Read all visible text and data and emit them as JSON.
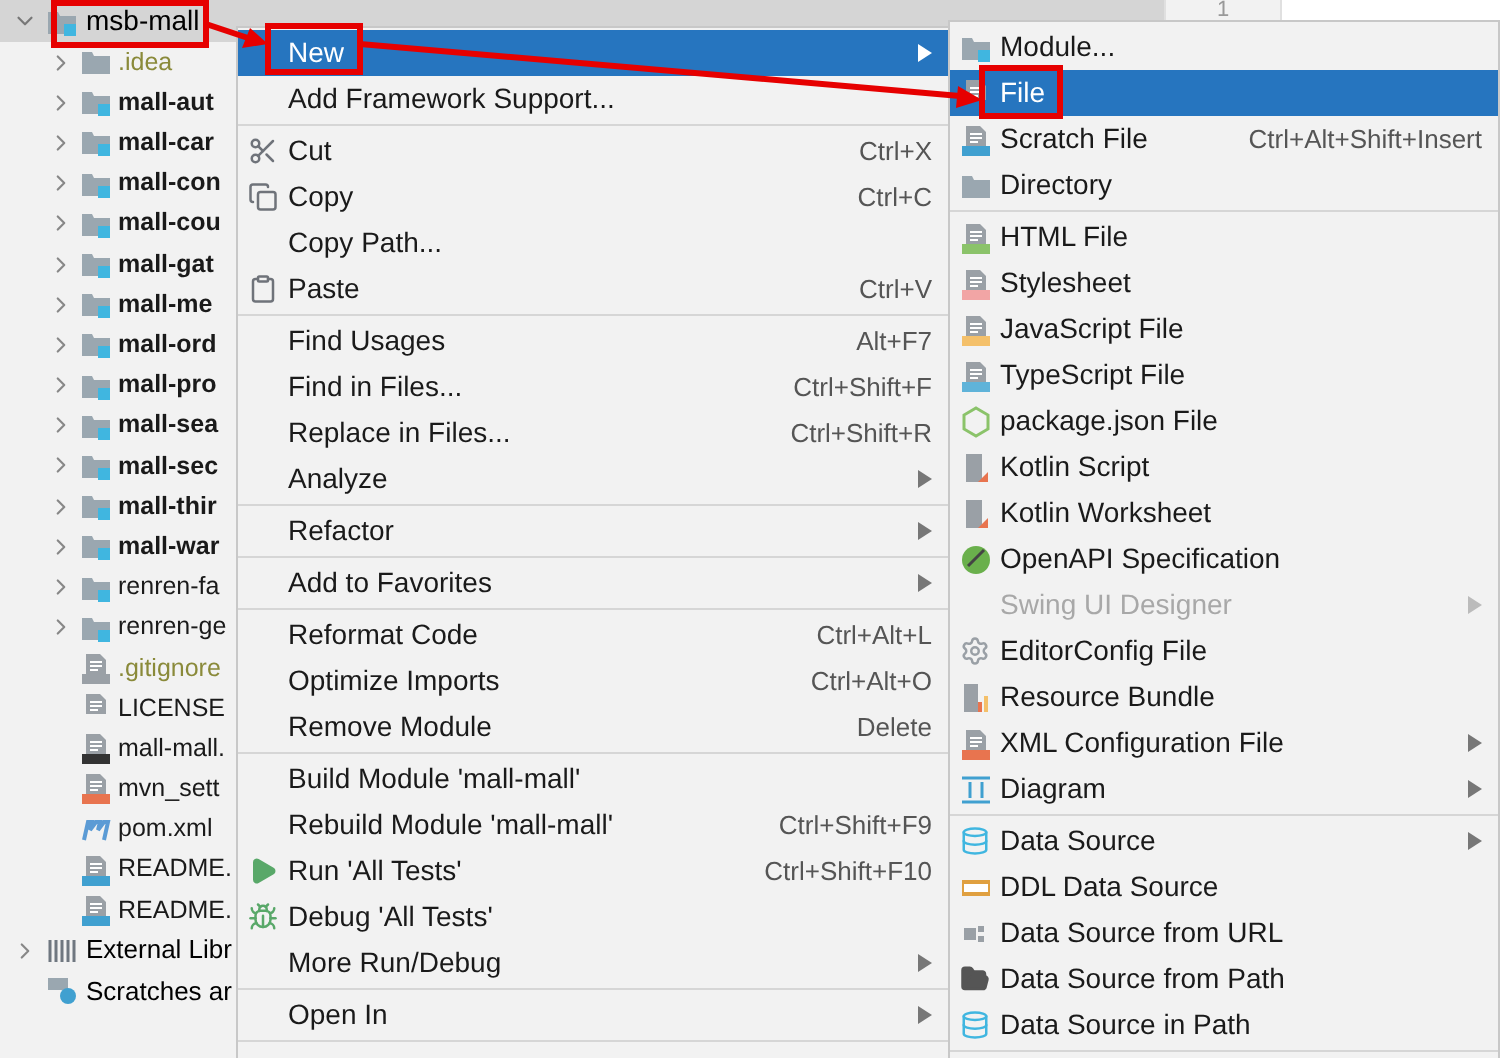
{
  "project_tree": {
    "root": {
      "name": "msb-mall",
      "expanded": true,
      "selected": true
    },
    "items": [
      {
        "label": ".idea",
        "kind": "folder",
        "bold": false,
        "ignored": true,
        "expandable": true
      },
      {
        "label": "mall-aut",
        "kind": "module",
        "bold": true,
        "ignored": false,
        "expandable": true
      },
      {
        "label": "mall-car",
        "kind": "module",
        "bold": true,
        "ignored": false,
        "expandable": true
      },
      {
        "label": "mall-con",
        "kind": "module",
        "bold": true,
        "ignored": false,
        "expandable": true
      },
      {
        "label": "mall-cou",
        "kind": "module",
        "bold": true,
        "ignored": false,
        "expandable": true
      },
      {
        "label": "mall-gat",
        "kind": "module",
        "bold": true,
        "ignored": false,
        "expandable": true
      },
      {
        "label": "mall-me",
        "kind": "module",
        "bold": true,
        "ignored": false,
        "expandable": true
      },
      {
        "label": "mall-ord",
        "kind": "module",
        "bold": true,
        "ignored": false,
        "expandable": true
      },
      {
        "label": "mall-pro",
        "kind": "module",
        "bold": true,
        "ignored": false,
        "expandable": true
      },
      {
        "label": "mall-sea",
        "kind": "module",
        "bold": true,
        "ignored": false,
        "expandable": true
      },
      {
        "label": "mall-sec",
        "kind": "module",
        "bold": true,
        "ignored": false,
        "expandable": true
      },
      {
        "label": "mall-thir",
        "kind": "module",
        "bold": true,
        "ignored": false,
        "expandable": true
      },
      {
        "label": "mall-war",
        "kind": "module",
        "bold": true,
        "ignored": false,
        "expandable": true
      },
      {
        "label": "renren-fa",
        "kind": "module",
        "bold": false,
        "ignored": false,
        "expandable": true
      },
      {
        "label": "renren-ge",
        "kind": "module",
        "bold": false,
        "ignored": false,
        "expandable": true
      },
      {
        "label": ".gitignore",
        "kind": "ignore",
        "bold": false,
        "ignored": true,
        "expandable": false
      },
      {
        "label": "LICENSE",
        "kind": "text",
        "bold": false,
        "ignored": false,
        "expandable": false
      },
      {
        "label": "mall-mall.",
        "kind": "iml",
        "bold": false,
        "ignored": false,
        "expandable": false
      },
      {
        "label": "mvn_sett",
        "kind": "xml",
        "bold": false,
        "ignored": false,
        "expandable": false
      },
      {
        "label": "pom.xml",
        "kind": "maven",
        "bold": false,
        "ignored": false,
        "expandable": false
      },
      {
        "label": "README.",
        "kind": "markdown",
        "bold": false,
        "ignored": false,
        "expandable": false
      },
      {
        "label": "README.",
        "kind": "markdown",
        "bold": false,
        "ignored": false,
        "expandable": false
      }
    ],
    "top_items": [
      {
        "label": "External Libr",
        "kind": "library",
        "expandable": true
      },
      {
        "label": "Scratches ar",
        "kind": "scratch",
        "expandable": false
      }
    ]
  },
  "editor": {
    "line_number": "1"
  },
  "context_menu": {
    "groups": [
      [
        {
          "label": "New",
          "submenu": true,
          "selected": true
        },
        {
          "label": "Add Framework Support...",
          "submenu": false,
          "selected": false
        }
      ],
      [
        {
          "label": "Cut",
          "shortcut": "Ctrl+X",
          "submenu": false,
          "selected": false
        },
        {
          "label": "Copy",
          "shortcut": "Ctrl+C",
          "submenu": false,
          "selected": false
        },
        {
          "label": "Copy Path...",
          "submenu": false,
          "selected": false
        },
        {
          "label": "Paste",
          "shortcut": "Ctrl+V",
          "submenu": false,
          "selected": false
        }
      ],
      [
        {
          "label": "Find Usages",
          "shortcut": "Alt+F7",
          "submenu": false,
          "selected": false
        },
        {
          "label": "Find in Files...",
          "shortcut": "Ctrl+Shift+F",
          "submenu": false,
          "selected": false
        },
        {
          "label": "Replace in Files...",
          "shortcut": "Ctrl+Shift+R",
          "submenu": false,
          "selected": false
        },
        {
          "label": "Analyze",
          "submenu": true,
          "selected": false
        }
      ],
      [
        {
          "label": "Refactor",
          "submenu": true,
          "selected": false
        }
      ],
      [
        {
          "label": "Add to Favorites",
          "submenu": true,
          "selected": false
        }
      ],
      [
        {
          "label": "Reformat Code",
          "shortcut": "Ctrl+Alt+L",
          "submenu": false,
          "selected": false
        },
        {
          "label": "Optimize Imports",
          "shortcut": "Ctrl+Alt+O",
          "submenu": false,
          "selected": false
        },
        {
          "label": "Remove Module",
          "shortcut": "Delete",
          "submenu": false,
          "selected": false
        }
      ],
      [
        {
          "label": "Build Module 'mall-mall'",
          "submenu": false,
          "selected": false
        },
        {
          "label": "Rebuild Module 'mall-mall'",
          "shortcut": "Ctrl+Shift+F9",
          "submenu": false,
          "selected": false
        },
        {
          "label": "Run 'All Tests'",
          "shortcut": "Ctrl+Shift+F10",
          "submenu": false,
          "selected": false
        },
        {
          "label": "Debug 'All Tests'",
          "submenu": false,
          "selected": false
        },
        {
          "label": "More Run/Debug",
          "submenu": true,
          "selected": false
        }
      ],
      [
        {
          "label": "Open In",
          "submenu": true,
          "selected": false
        }
      ]
    ]
  },
  "new_submenu": {
    "groups": [
      [
        {
          "label": "Module...",
          "submenu": false,
          "selected": false,
          "disabled": false
        },
        {
          "label": "File",
          "submenu": false,
          "selected": true,
          "disabled": false
        },
        {
          "label": "Scratch File",
          "shortcut": "Ctrl+Alt+Shift+Insert",
          "submenu": false,
          "selected": false,
          "disabled": false
        },
        {
          "label": "Directory",
          "submenu": false,
          "selected": false,
          "disabled": false
        }
      ],
      [
        {
          "label": "HTML File",
          "submenu": false,
          "selected": false,
          "disabled": false
        },
        {
          "label": "Stylesheet",
          "submenu": false,
          "selected": false,
          "disabled": false
        },
        {
          "label": "JavaScript File",
          "submenu": false,
          "selected": false,
          "disabled": false
        },
        {
          "label": "TypeScript File",
          "submenu": false,
          "selected": false,
          "disabled": false
        },
        {
          "label": "package.json File",
          "submenu": false,
          "selected": false,
          "disabled": false
        },
        {
          "label": "Kotlin Script",
          "submenu": false,
          "selected": false,
          "disabled": false
        },
        {
          "label": "Kotlin Worksheet",
          "submenu": false,
          "selected": false,
          "disabled": false
        },
        {
          "label": "OpenAPI Specification",
          "submenu": false,
          "selected": false,
          "disabled": false
        },
        {
          "label": "Swing UI Designer",
          "submenu": true,
          "selected": false,
          "disabled": true
        },
        {
          "label": "EditorConfig File",
          "submenu": false,
          "selected": false,
          "disabled": false
        },
        {
          "label": "Resource Bundle",
          "submenu": false,
          "selected": false,
          "disabled": false
        },
        {
          "label": "XML Configuration File",
          "submenu": true,
          "selected": false,
          "disabled": false
        },
        {
          "label": "Diagram",
          "submenu": true,
          "selected": false,
          "disabled": false
        }
      ],
      [
        {
          "label": "Data Source",
          "submenu": true,
          "selected": false,
          "disabled": false
        },
        {
          "label": "DDL Data Source",
          "submenu": false,
          "selected": false,
          "disabled": false
        },
        {
          "label": "Data Source from URL",
          "submenu": false,
          "selected": false,
          "disabled": false
        },
        {
          "label": "Data Source from Path",
          "submenu": false,
          "selected": false,
          "disabled": false
        },
        {
          "label": "Data Source in Path",
          "submenu": false,
          "selected": false,
          "disabled": false
        }
      ]
    ]
  }
}
